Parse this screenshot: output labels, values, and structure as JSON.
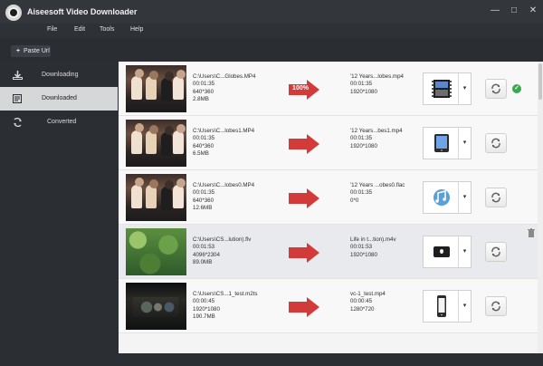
{
  "app": {
    "title": "Aiseesoft Video Downloader",
    "window": {
      "min": "—",
      "max": "□",
      "close": "✕"
    }
  },
  "menu": {
    "items": [
      "File",
      "Edit",
      "Tools",
      "Help"
    ]
  },
  "toolbar": {
    "paste_url_label": "Paste Url",
    "paste_icon": "+"
  },
  "sidebar": {
    "items": [
      {
        "label": "Downloading",
        "icon": "download-icon",
        "active": false
      },
      {
        "label": "Downloaded",
        "icon": "downloaded-icon",
        "active": true
      },
      {
        "label": "Converted",
        "icon": "converted-icon",
        "active": false
      }
    ]
  },
  "rows": [
    {
      "thumb": "people",
      "source": {
        "path": "C:\\Users\\C...Globes.MP4",
        "duration": "00:01:35",
        "resolution": "640*360",
        "size": "2.8MB"
      },
      "progress": "100%",
      "output": {
        "name": "'12 Years...lobes.mp4",
        "duration": "00:01:35",
        "resolution": "1920*1080"
      },
      "profile_icon": "film-icon",
      "done": true
    },
    {
      "thumb": "people",
      "source": {
        "path": "C:\\Users\\C...lobes1.MP4",
        "duration": "00:01:35",
        "resolution": "640*360",
        "size": "6.5MB"
      },
      "progress": "",
      "output": {
        "name": "'12 Years...bes1.mp4",
        "duration": "00:01:35",
        "resolution": "1920*1080"
      },
      "profile_icon": "tablet-icon",
      "done": false
    },
    {
      "thumb": "people",
      "source": {
        "path": "C:\\Users\\C...lobes0.MP4",
        "duration": "00:01:35",
        "resolution": "640*360",
        "size": "12.6MB"
      },
      "progress": "",
      "output": {
        "name": "'12 Years ...obes0.flac",
        "duration": "00:01:35",
        "resolution": "0*0"
      },
      "profile_icon": "audio-icon",
      "done": false
    },
    {
      "thumb": "green",
      "source": {
        "path": "C:\\Users\\CS...lution).flv",
        "duration": "00:01:53",
        "resolution": "4096*2304",
        "size": "89.0MB"
      },
      "progress": "",
      "output": {
        "name": "Life in t...tion).m4v",
        "duration": "00:01:53",
        "resolution": "1920*1080"
      },
      "profile_icon": "apple-tv-icon",
      "done": false
    },
    {
      "thumb": "dark",
      "source": {
        "path": "C:\\Users\\CS...1_test.m2ts",
        "duration": "00:00:45",
        "resolution": "1920*1080",
        "size": "190.7MB"
      },
      "progress": "",
      "output": {
        "name": "vc-1_test.mp4",
        "duration": "00:00:45",
        "resolution": "1280*720"
      },
      "profile_icon": "phone-icon",
      "done": false
    }
  ]
}
